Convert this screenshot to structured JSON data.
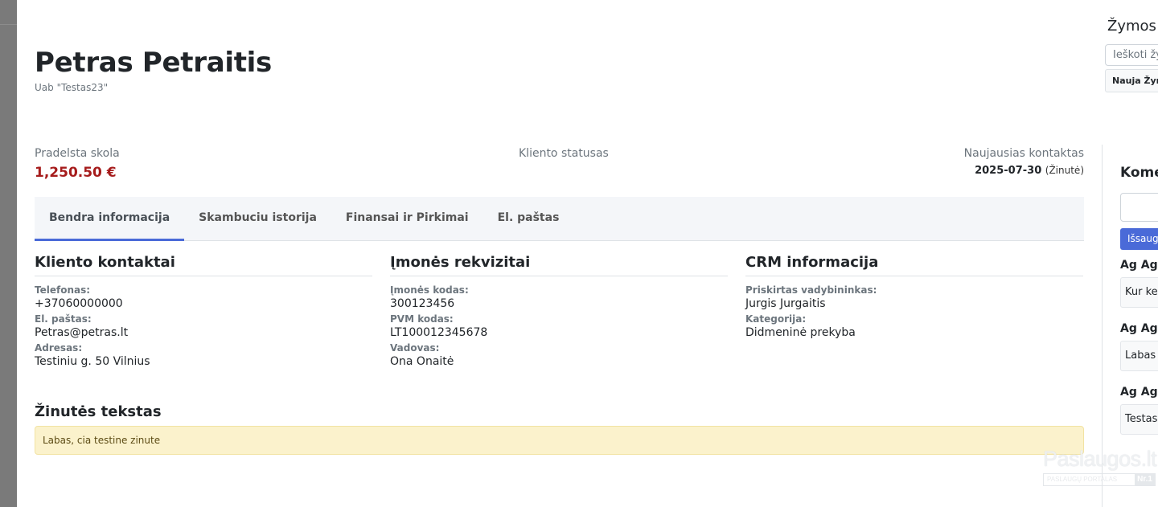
{
  "customer": {
    "name": "Petras Petraitis",
    "company": "Uab \"Testas23\""
  },
  "summary": {
    "debt_label": "Pradelsta skola",
    "debt_value": "1,250.50 €",
    "status_label": "Kliento statusas",
    "last_contact_label": "Naujausias kontaktas",
    "last_contact_date": "2025-07-30",
    "last_contact_note": "(Žinutė)"
  },
  "tabs": [
    {
      "label": "Bendra informacija"
    },
    {
      "label": "Skambuciu istorija"
    },
    {
      "label": "Finansai ir Pirkimai"
    },
    {
      "label": "El. paštas"
    }
  ],
  "contacts": {
    "title": "Kliento kontaktai",
    "phone_label": "Telefonas:",
    "phone": "+37060000000",
    "email_label": "El. paštas:",
    "email": "Petras@petras.lt",
    "address_label": "Adresas:",
    "address": "Testiniu g. 50 Vilnius"
  },
  "company_details": {
    "title": "Įmonės rekvizitai",
    "code_label": "Įmonės kodas:",
    "code": "300123456",
    "vat_label": "PVM kodas:",
    "vat": "LT100012345678",
    "manager_label": "Vadovas:",
    "manager": "Ona Onaitė"
  },
  "crm": {
    "title": "CRM informacija",
    "assigned_label": "Priskirtas vadybininkas:",
    "assigned": "Jurgis Jurgaitis",
    "category_label": "Kategorija:",
    "category": "Didmeninė prekyba"
  },
  "message": {
    "title": "Žinutės tekstas",
    "text": "Labas, cia testine zinute"
  },
  "comments": {
    "title": "Kome",
    "save_label": "Išsauge",
    "items": [
      {
        "author": "Ag Ag",
        "text": "Kur ke"
      },
      {
        "author": "Ag Ag",
        "text": "Labas"
      },
      {
        "author": "Ag Ag",
        "text": "Testas"
      }
    ]
  },
  "tags": {
    "title": "Žymos",
    "search_placeholder": "Ieškoti žy",
    "new_label": "Nauja Žymo"
  },
  "watermark": {
    "brand": "Paslaugos.lt",
    "sub": "PASLAUGŲ PORTALAS",
    "rank": "Nr.1"
  },
  "colors": {
    "debt": "#a61c1c",
    "accent": "#4a6ad8",
    "message_bg": "#fbf2cc"
  }
}
